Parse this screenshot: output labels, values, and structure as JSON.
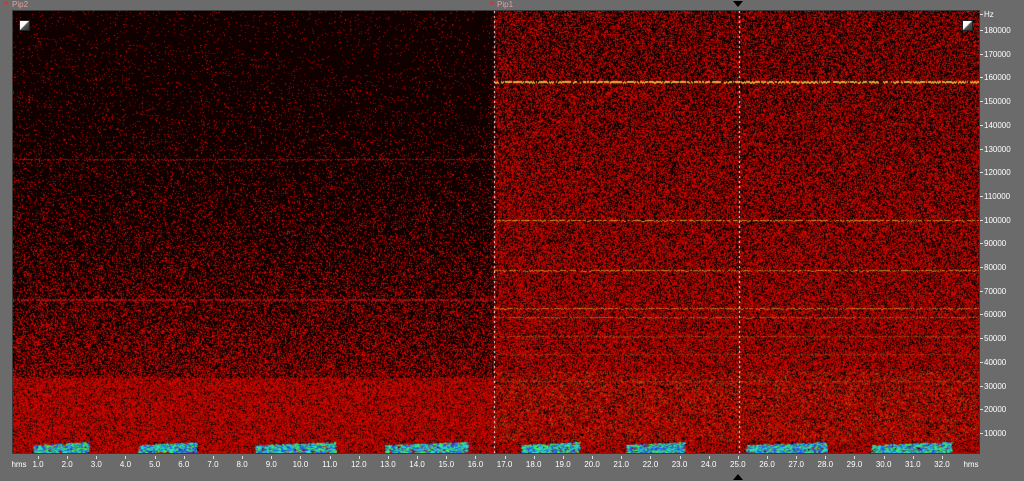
{
  "selections": [
    {
      "label": "Pip2",
      "color": "#e06060"
    },
    {
      "label": "Pip1",
      "color": "#e06060"
    }
  ],
  "y_axis": {
    "unit": "Hz",
    "ticks": [
      "180000",
      "170000",
      "160000",
      "150000",
      "140000",
      "130000",
      "120000",
      "110000",
      "100000",
      "90000",
      "80000",
      "70000",
      "60000",
      "50000",
      "40000",
      "30000",
      "20000",
      "10000"
    ]
  },
  "x_axis": {
    "unit": "hms",
    "ticks": [
      "1.0",
      "2.0",
      "3.0",
      "4.0",
      "5.0",
      "6.0",
      "7.0",
      "8.0",
      "9.0",
      "10.0",
      "11.0",
      "12.0",
      "13.0",
      "14.0",
      "15.0",
      "16.0",
      "17.0",
      "18.0",
      "19.0",
      "20.0",
      "21.0",
      "22.0",
      "23.0",
      "24.0",
      "25.0",
      "26.0",
      "27.0",
      "28.0",
      "29.0",
      "30.0",
      "31.0",
      "32.0"
    ]
  },
  "colors": {
    "background": "#120000",
    "noise": "#b00000",
    "band": "#e8b030",
    "call_blue": "#2050ff",
    "call_cyan": "#20e0e0",
    "call_green": "#40ff40"
  },
  "icons": [
    "zoom-left-icon",
    "zoom-right-icon",
    "cursor-top-marker-icon",
    "cursor-bottom-marker-icon"
  ]
}
